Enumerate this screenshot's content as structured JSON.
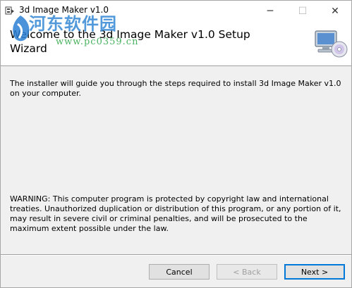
{
  "window": {
    "title": "3d Image Maker v1.0",
    "controls": {
      "minimize": "─",
      "maximize": "☐",
      "close": "✕"
    }
  },
  "banner": {
    "heading": "Welcome to the 3d Image Maker v1.0 Setup Wizard",
    "watermark": {
      "text": "河东软件园",
      "url": "www.pc0359.cn"
    },
    "icon": "computer-cd-icon"
  },
  "body": {
    "intro": "The installer will guide you through the steps required to install 3d Image Maker v1.0 on your computer.",
    "warning": "WARNING: This computer program is protected by copyright law and international treaties. Unauthorized duplication or distribution of this program, or any portion of it, may result in severe civil or criminal penalties, and will be prosecuted to the maximum extent possible under the law."
  },
  "buttons": {
    "cancel": "Cancel",
    "back": "< Back",
    "next": "Next >"
  },
  "colors": {
    "accent": "#0078d7",
    "watermark_blue": "#3f8fd6",
    "watermark_green": "#2aa544"
  }
}
